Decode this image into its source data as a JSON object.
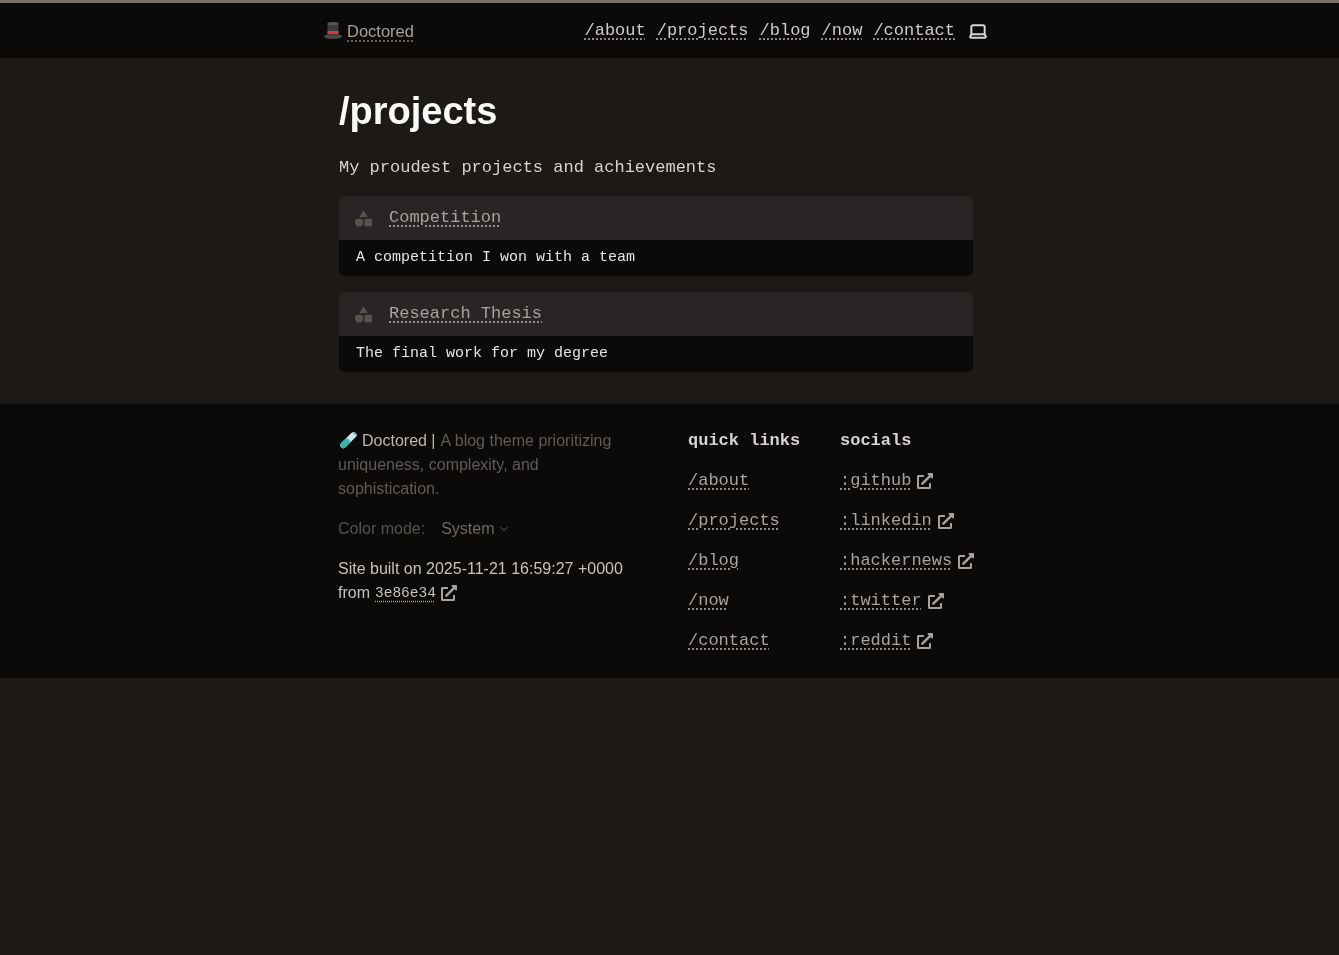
{
  "header": {
    "brand": "Doctored",
    "nav": [
      "/about",
      "/projects",
      "/blog",
      "/now",
      "/contact"
    ]
  },
  "page": {
    "title": "/projects",
    "subtitle": "My proudest projects and achievements"
  },
  "projects": [
    {
      "title": "Competition",
      "description": "A competition I won with a team"
    },
    {
      "title": "Research Thesis",
      "description": "The final work for my degree"
    }
  ],
  "footer": {
    "brand": "Doctored |",
    "tagline_lines": [
      "A blog theme prioritizing",
      "uniqueness, complexity, and",
      "sophistication."
    ],
    "color_mode": {
      "label": "Color mode:",
      "value": "System"
    },
    "build": {
      "text": "Site built on 2025-11-21 16:59:27 +0000",
      "from_label": "from",
      "commit": "3e86e34"
    },
    "quick_links": {
      "heading": "quick links",
      "links": [
        "/about",
        "/projects",
        "/blog",
        "/now",
        "/contact"
      ]
    },
    "socials": {
      "heading": "socials",
      "links": [
        ":github",
        ":linkedin",
        ":hackernews",
        ":twitter",
        ":reddit"
      ]
    }
  }
}
